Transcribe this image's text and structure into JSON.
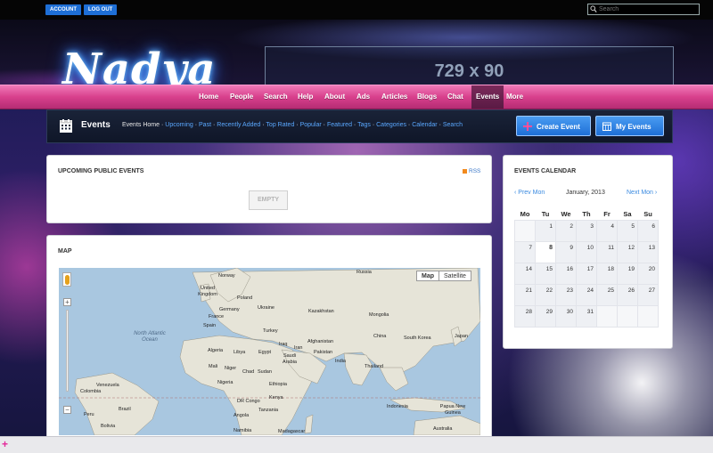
{
  "top": {
    "account_label": "ACCOUNT",
    "logout_label": "LOG OUT",
    "search_placeholder": "Search"
  },
  "header": {
    "logo": "Nadya",
    "banner": "729 x 90"
  },
  "nav": [
    "Home",
    "People",
    "Search",
    "Help",
    "About",
    "Ads",
    "Articles",
    "Blogs",
    "Chat",
    "Events",
    "More"
  ],
  "nav_active": "Events",
  "events_bar": {
    "title": "Events",
    "home": "Events Home",
    "links": [
      "Upcoming",
      "Past",
      "Recently Added",
      "Top Rated",
      "Popular",
      "Featured",
      "Tags",
      "Categories",
      "Calendar",
      "Search"
    ],
    "separator": " · ",
    "create_label": "Create Event",
    "my_label": "My Events"
  },
  "upcoming": {
    "title": "UPCOMING PUBLIC EVENTS",
    "rss": "RSS",
    "empty": "EMPTY"
  },
  "map": {
    "title": "MAP",
    "map_btn": "Map",
    "satellite_btn": "Satellite",
    "zoom_in": "+",
    "zoom_out": "−",
    "labels": {
      "russia": "Russia",
      "norway": "Norway",
      "united_kingdom": "United Kingdom",
      "poland": "Poland",
      "germany": "Germany",
      "ukraine": "Ukraine",
      "kazakhstan": "Kazakhstan",
      "mongolia": "Mongolia",
      "france": "France",
      "spain": "Spain",
      "turkey": "Turkey",
      "north_atlantic": "North Atlantic Ocean",
      "afghanistan": "Afghanistan",
      "china": "China",
      "south_korea": "South Korea",
      "japan": "Japan",
      "iraq": "Iraq",
      "iran": "Iran",
      "libya": "Libya",
      "egypt": "Egypt",
      "algeria": "Algeria",
      "saudi_arabia": "Saudi Arabia",
      "pakistan": "Pakistan",
      "india": "India",
      "thailand": "Thailand",
      "mali": "Mali",
      "niger": "Niger",
      "chad": "Chad",
      "sudan": "Sudan",
      "nigeria": "Nigeria",
      "ethiopia": "Ethiopia",
      "kenya": "Kenya",
      "dr_congo": "DR Congo",
      "venezuela": "Venezuela",
      "colombia": "Colombia",
      "peru": "Peru",
      "brazil": "Brazil",
      "indonesia": "Indonesia",
      "papua_new_guinea": "Papua New Guinea",
      "tanzania": "Tanzania",
      "angola": "Angola",
      "bolivia": "Bolivia",
      "namibia": "Namibia",
      "madagascar": "Madagascar",
      "australia": "Australia"
    }
  },
  "calendar": {
    "title": "EVENTS CALENDAR",
    "prev": "‹ Prev Mon",
    "month": "January, 2013",
    "next": "Next Mon ›",
    "weekdays": [
      "Mo",
      "Tu",
      "We",
      "Th",
      "Fr",
      "Sa",
      "Su"
    ],
    "weeks": [
      [
        "",
        "1",
        "2",
        "3",
        "4",
        "5",
        "6"
      ],
      [
        "7",
        "8",
        "9",
        "10",
        "11",
        "12",
        "13"
      ],
      [
        "14",
        "15",
        "16",
        "17",
        "18",
        "19",
        "20"
      ],
      [
        "21",
        "22",
        "23",
        "24",
        "25",
        "26",
        "27"
      ],
      [
        "28",
        "29",
        "30",
        "31",
        "",
        "",
        ""
      ]
    ],
    "today": "8"
  },
  "bottom": {
    "plus": "+"
  }
}
